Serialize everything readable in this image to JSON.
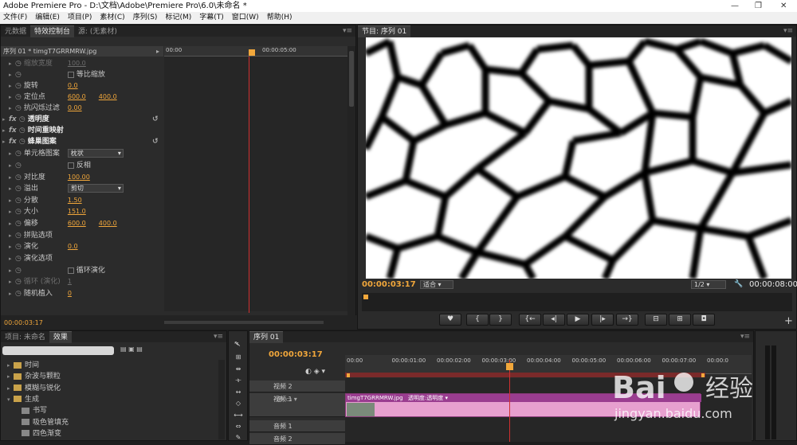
{
  "app": {
    "title": "Adobe Premiere Pro - D:\\文档\\Adobe\\Premiere Pro\\6.0\\未命名 *"
  },
  "menu": [
    "文件(F)",
    "编辑(E)",
    "项目(P)",
    "素材(C)",
    "序列(S)",
    "标记(M)",
    "字幕(T)",
    "窗口(W)",
    "帮助(H)"
  ],
  "effects_panel": {
    "tabs": [
      "元数据",
      "特效控制台",
      "源: (无素材)"
    ],
    "header": "序列 01 * timgT7GRRMRW.jpg",
    "ruler": [
      "00:00",
      "00:00:05:00"
    ],
    "rows": [
      {
        "label": "缩放宽度",
        "value": "100.0",
        "dim": true
      },
      {
        "label": "等比缩放",
        "checkbox": true
      },
      {
        "label": "旋转",
        "value": "0.0"
      },
      {
        "label": "定位点",
        "value": "600.0",
        "value2": "400.0"
      },
      {
        "label": "抗闪烁过滤",
        "value": "0.00"
      },
      {
        "label": "透明度",
        "fx": true
      },
      {
        "label": "时间重映射",
        "fx": true
      },
      {
        "label": "蜂巢图案",
        "fx": true
      },
      {
        "label": "单元格图案",
        "dropdown": "枕状"
      },
      {
        "label": "反相",
        "checkbox": true
      },
      {
        "label": "对比度",
        "value": "100.00"
      },
      {
        "label": "溢出",
        "dropdown": "剪切"
      },
      {
        "label": "分散",
        "value": "1.50"
      },
      {
        "label": "大小",
        "value": "151.0"
      },
      {
        "label": "偏移",
        "value": "600.0",
        "value2": "400.0"
      },
      {
        "label": "拼贴选项"
      },
      {
        "label": "演化",
        "value": "0.0"
      },
      {
        "label": "演化选项"
      },
      {
        "label": "循环演化",
        "checkbox": true
      },
      {
        "label": "循环 (演化)",
        "value": "1",
        "dim": true
      },
      {
        "label": "随机植入",
        "value": "0"
      }
    ],
    "timecode": "00:00:03:17"
  },
  "program_monitor": {
    "tab": "节目: 序列 01",
    "timecode": "00:00:03:17",
    "fit": "适合",
    "resolution": "1/2",
    "duration": "00:00:08:00",
    "controls": [
      "♥",
      "{",
      "}",
      "{←",
      "◂|",
      "▶",
      "|▸",
      "→}",
      "⊟",
      "⊞",
      "◘"
    ]
  },
  "project_panel": {
    "tabs": [
      "项目: 未命名",
      "效果"
    ],
    "items": [
      "时间",
      "杂波与颗粒",
      "模糊与锐化",
      "生成",
      "书写",
      "吸色管填充",
      "四色渐变"
    ]
  },
  "timeline": {
    "tab": "序列 01",
    "timecode": "00:00:03:17",
    "ruler": [
      "00:00",
      "00:00:01:00",
      "00:00:02:00",
      "00:00:03:00",
      "00:00:04:00",
      "00:00:05:00",
      "00:00:06:00",
      "00:00:07:00",
      "00:00:0"
    ],
    "tracks": [
      "视频 2",
      "视频 1",
      "音频 1",
      "音频 2"
    ],
    "clip": {
      "name": "timgT7GRRMRW.jpg",
      "effect": "透明度:透明度"
    }
  },
  "watermark": {
    "logo": "Bai 经验",
    "url": "jingyan.baidu.com"
  }
}
